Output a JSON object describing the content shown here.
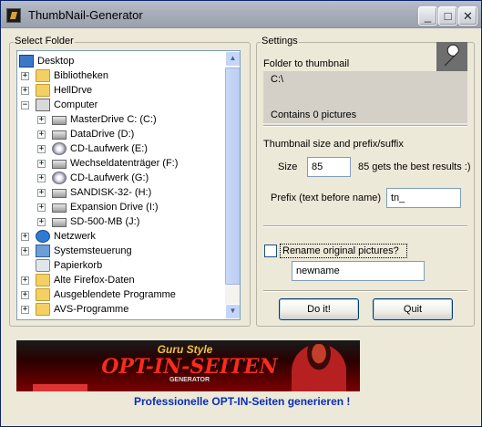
{
  "window": {
    "title": "ThumbNail-Generator",
    "minimize_glyph": "_",
    "maximize_glyph": "□",
    "close_glyph": "✕"
  },
  "select_folder": {
    "label": "Select Folder",
    "items": [
      {
        "label": "Desktop",
        "icon": "desktop-icon",
        "level": 0,
        "expander": ""
      },
      {
        "label": "Bibliotheken",
        "icon": "library-folder-icon",
        "level": 1,
        "expander": "+"
      },
      {
        "label": "HellDrve",
        "icon": "user-folder-icon",
        "level": 1,
        "expander": "+"
      },
      {
        "label": "Computer",
        "icon": "computer-icon",
        "level": 1,
        "expander": "−"
      },
      {
        "label": "MasterDrive C: (C:)",
        "icon": "hard-drive-icon",
        "level": 2,
        "expander": "+"
      },
      {
        "label": "DataDrive (D:)",
        "icon": "hard-drive-icon",
        "level": 2,
        "expander": "+"
      },
      {
        "label": "CD-Laufwerk (E:)",
        "icon": "cd-drive-icon",
        "level": 2,
        "expander": "+"
      },
      {
        "label": "Wechseldatenträger (F:)",
        "icon": "removable-drive-icon",
        "level": 2,
        "expander": "+"
      },
      {
        "label": "CD-Laufwerk (G:)",
        "icon": "cd-drive-icon",
        "level": 2,
        "expander": "+"
      },
      {
        "label": "SANDISK-32- (H:)",
        "icon": "removable-drive-icon",
        "level": 2,
        "expander": "+"
      },
      {
        "label": "Expansion Drive (I:)",
        "icon": "hard-drive-icon",
        "level": 2,
        "expander": "+"
      },
      {
        "label": "SD-500-MB (J:)",
        "icon": "removable-drive-icon",
        "level": 2,
        "expander": "+"
      },
      {
        "label": "Netzwerk",
        "icon": "network-icon",
        "level": 1,
        "expander": "+"
      },
      {
        "label": "Systemsteuerung",
        "icon": "control-panel-icon",
        "level": 1,
        "expander": "+"
      },
      {
        "label": "Papierkorb",
        "icon": "recycle-bin-icon",
        "level": 1,
        "expander": ""
      },
      {
        "label": "Alte Firefox-Daten",
        "icon": "folder-icon",
        "level": 1,
        "expander": "+"
      },
      {
        "label": "Ausgeblendete Programme",
        "icon": "folder-icon",
        "level": 1,
        "expander": "+"
      },
      {
        "label": "AVS-Programme",
        "icon": "folder-icon",
        "level": 1,
        "expander": "+"
      }
    ]
  },
  "settings": {
    "label": "Settings",
    "folder_to_thumbnail_label": "Folder to thumbnail",
    "folder_path": "C:\\",
    "contains_text": "Contains 0 pictures",
    "size_section_label": "Thumbnail size and prefix/suffix",
    "size_label": "Size",
    "size_value": "85",
    "size_hint": "85 gets the best results :)",
    "prefix_label": "Prefix (text before name)",
    "prefix_value": "tn_",
    "rename_label": "Rename original pictures?",
    "rename_checked": false,
    "rename_value": "newname",
    "doit_button": "Do it!",
    "quit_button": "Quit"
  },
  "banner": {
    "top_text": "Guru Style",
    "main_text": "OPT-IN-SEITEN",
    "sub_text": "GENERATOR"
  },
  "promo_link": "Professionelle OPT-IN-Seiten generieren !"
}
